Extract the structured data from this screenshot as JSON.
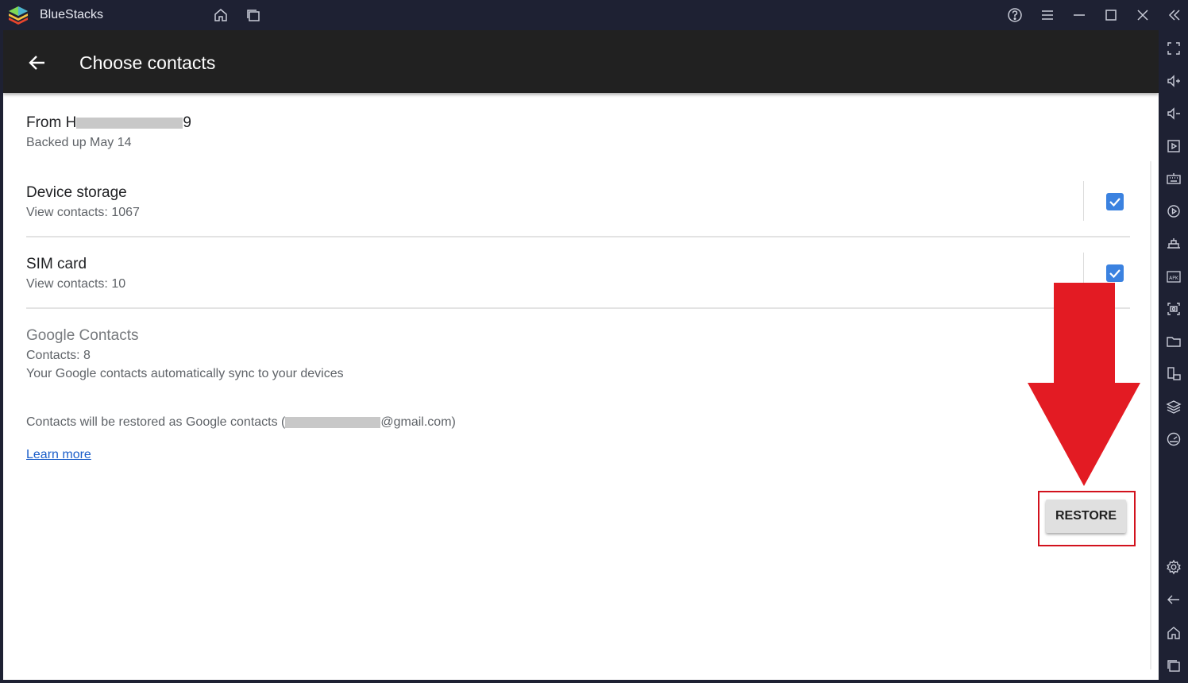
{
  "titlebar": {
    "app_name": "BlueStacks"
  },
  "appbar": {
    "title": "Choose contacts"
  },
  "backup_source": {
    "from_prefix": "From H",
    "from_suffix": "9",
    "backed_up": "Backed up May 14"
  },
  "sources": [
    {
      "title": "Device storage",
      "subtitle": "View contacts: 1067",
      "checked": true
    },
    {
      "title": "SIM card",
      "subtitle": "View contacts: 10",
      "checked": true
    }
  ],
  "google": {
    "title": "Google Contacts",
    "count": "Contacts: 8",
    "description": "Your Google contacts automatically sync to your devices",
    "restore_note_prefix": "Contacts will be restored as Google contacts (",
    "restore_note_suffix": "@gmail.com)",
    "learn_more": "Learn more"
  },
  "actions": {
    "restore_label": "RESTORE"
  },
  "colors": {
    "accent_checkbox": "#3b82e0",
    "highlight_red": "#e31b23",
    "appbar_bg": "#212121",
    "chrome_bg": "#1e2133"
  },
  "icons": {
    "titlebar": [
      "home-icon",
      "recent-apps-icon",
      "help-icon",
      "menu-icon",
      "minimize-icon",
      "maximize-icon",
      "close-icon",
      "collapse-sidebar-icon"
    ],
    "sidebar": [
      "fullscreen-icon",
      "volume-up-icon",
      "volume-down-icon",
      "media-manager-icon",
      "keyboard-icon",
      "macro-recorder-icon",
      "multi-instance-icon",
      "install-apk-icon",
      "screenshot-icon",
      "folder-icon",
      "rotate-icon",
      "layers-icon",
      "performance-icon",
      "settings-icon",
      "back-icon",
      "android-home-icon",
      "android-recents-icon"
    ]
  }
}
